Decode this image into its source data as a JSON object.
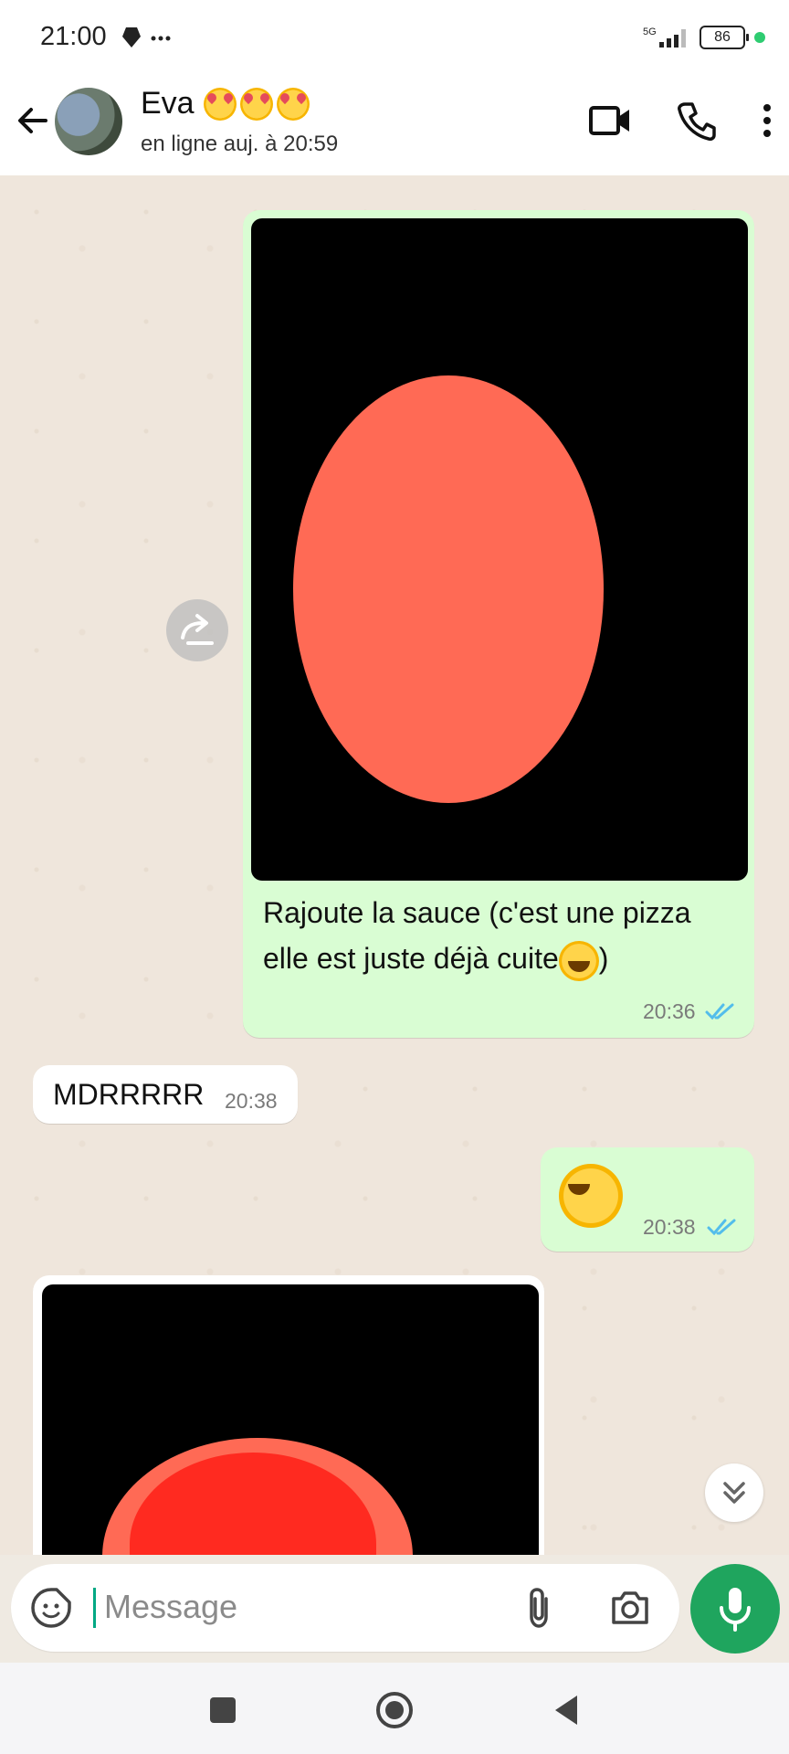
{
  "status": {
    "time": "21:00",
    "battery": "86"
  },
  "header": {
    "name": "Eva",
    "status": "en ligne auj. à 20:59"
  },
  "messages": [
    {
      "direction": "out",
      "caption_line1": "Rajoute la sauce (c'est une pizza",
      "caption_line2": "elle est juste déjà cuite",
      "caption_end": ")",
      "time": "20:36"
    },
    {
      "direction": "in",
      "text": "MDRRRRR",
      "time": "20:38"
    },
    {
      "direction": "out",
      "time": "20:38"
    }
  ],
  "composer": {
    "placeholder": "Message"
  },
  "colors": {
    "outgoing": "#d9fdd3",
    "incoming": "#ffffff",
    "accent": "#1fa55e",
    "tick": "#53bdeb"
  },
  "icons": [
    "back-arrow-icon",
    "video-call-icon",
    "phone-icon",
    "more-vert-icon",
    "forward-icon",
    "scroll-down-icon",
    "sticker-icon",
    "attach-icon",
    "camera-icon",
    "mic-icon"
  ]
}
